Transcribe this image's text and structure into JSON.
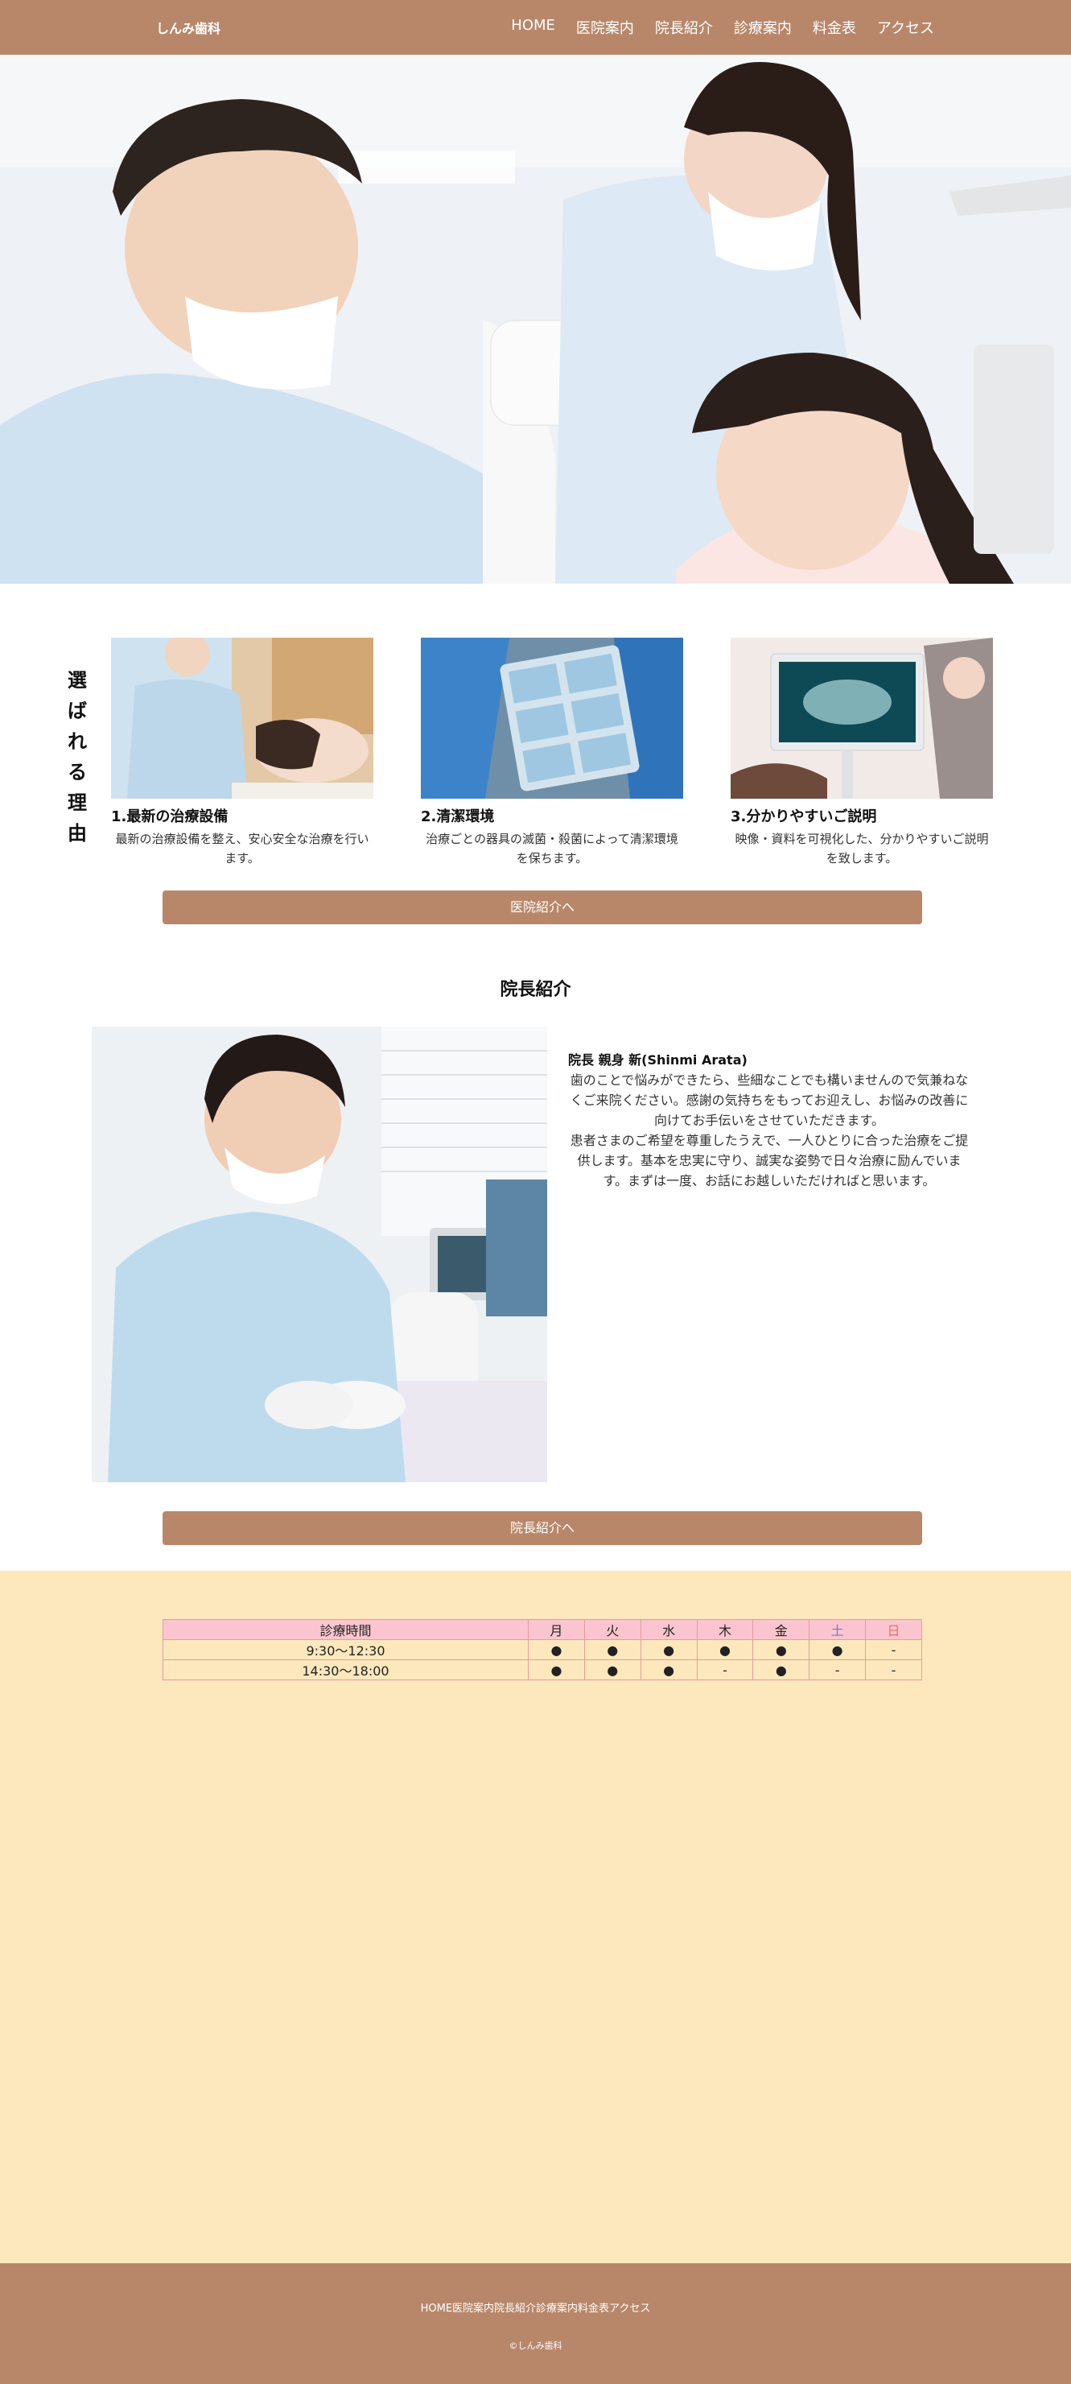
{
  "header": {
    "logo": "しんみ歯科",
    "nav": [
      "HOME",
      "医院案内",
      "院長紹介",
      "診療案内",
      "料金表",
      "アクセス"
    ]
  },
  "reasons": {
    "title": "選ばれる理由",
    "items": [
      {
        "title": "1.最新の治療設備",
        "desc": "最新の治療設備を整え、安心安全な治療を行います。"
      },
      {
        "title": "2.清潔環境",
        "desc": "治療ごとの器具の滅菌・殺菌によって清潔環境を保ちます。"
      },
      {
        "title": "3.分かりやすいご説明",
        "desc": "映像・資料を可視化した、分かりやすいご説明を致します。"
      }
    ],
    "button": "医院紹介へ"
  },
  "director": {
    "heading": "院長紹介",
    "name": "院長 親身 新(Shinmi Arata)",
    "paragraph1": "歯のことで悩みができたら、些細なことでも構いませんので気兼ねなくご来院ください。感謝の気持ちをもってお迎えし、お悩みの改善に向けてお手伝いをさせていただきます。",
    "paragraph2": "患者さまのご希望を尊重したうえで、一人ひとりに合った治療をご提供します。基本を忠実に守り、誠実な姿勢で日々治療に励んでいます。まずは一度、お話にお越しいただければと思います。",
    "button": "院長紹介へ"
  },
  "schedule": {
    "header": [
      "診療時間",
      "月",
      "火",
      "水",
      "木",
      "金",
      "土",
      "日"
    ],
    "rows": [
      [
        "9:30〜12:30",
        "●",
        "●",
        "●",
        "●",
        "●",
        "●",
        "-"
      ],
      [
        "14:30〜18:00",
        "●",
        "●",
        "●",
        "-",
        "●",
        "-",
        "-"
      ]
    ]
  },
  "footer": {
    "nav": "HOME医院案内院長紹介診療案内料金表アクセス",
    "copyright": "©しんみ歯科"
  },
  "colors": {
    "brand": "#b8876a",
    "schedule_bg": "#fde8bd",
    "table_header": "#fbc5cf"
  }
}
